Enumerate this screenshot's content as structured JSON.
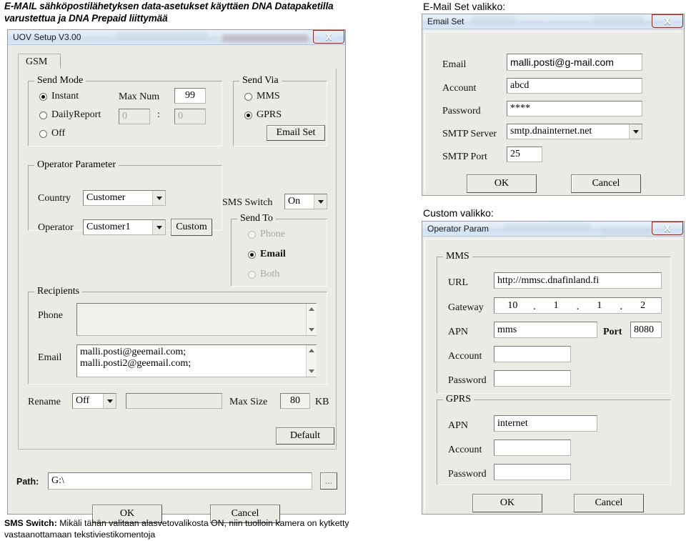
{
  "document": {
    "heading": "E-MAIL sähköpostilähetyksen data-asetukset käyttäen DNA Datapaketilla varustettua ja DNA Prepaid liittymää",
    "footnote_bold": "SMS Switch:",
    "footnote_rest": " Mikäli tähän valitaan alasvetovalikosta ON, niin tuolloin kamera on kytketty vastaanottamaan tekstiviestikomentoja",
    "caption_email_set": "E-Mail Set valikko:",
    "caption_custom": "Custom valikko:"
  },
  "main_dialog": {
    "title": "UOV Setup V3.00",
    "close_label": "X",
    "tab": "GSM",
    "send_mode": {
      "legend": "Send Mode",
      "options": [
        {
          "label": "Instant",
          "selected": true,
          "disabled": false
        },
        {
          "label": "DailyReport",
          "selected": false,
          "disabled": false
        },
        {
          "label": "Off",
          "selected": false,
          "disabled": false
        }
      ],
      "max_num_label": "Max Num",
      "max_num_value": "99",
      "daily_hour": "0",
      "daily_separator": ":",
      "daily_minute": "0"
    },
    "send_via": {
      "legend": "Send Via",
      "options": [
        {
          "label": "MMS",
          "selected": false
        },
        {
          "label": "GPRS",
          "selected": true
        }
      ],
      "email_set_button": "Email Set"
    },
    "operator_parameter": {
      "legend": "Operator Parameter",
      "country_label": "Country",
      "country_value": "Customer",
      "operator_label": "Operator",
      "operator_value": "Customer1",
      "custom_button": "Custom"
    },
    "sms_switch": {
      "label": "SMS Switch",
      "value": "On"
    },
    "send_to": {
      "legend": "Send To",
      "options": [
        {
          "label": "Phone",
          "selected": false,
          "disabled": true
        },
        {
          "label": "Email",
          "selected": true,
          "disabled": false
        },
        {
          "label": "Both",
          "selected": false,
          "disabled": true
        }
      ]
    },
    "recipients": {
      "legend": "Recipients",
      "phone_label": "Phone",
      "phone_value": "",
      "email_label": "Email",
      "email_value": "malli.posti@geemail.com;\nmalli.posti2@geemail.com;"
    },
    "rename": {
      "label": "Rename",
      "value": "Off",
      "text_value": ""
    },
    "max_size": {
      "label": "Max Size",
      "value": "80",
      "unit": "KB"
    },
    "default_button": "Default",
    "path": {
      "label": "Path:",
      "value": "G:\\",
      "browse_button": "..."
    },
    "ok_button": "OK",
    "cancel_button": "Cancel"
  },
  "email_set_dialog": {
    "title": "Email Set",
    "close_label": "X",
    "fields": [
      {
        "label": "Email",
        "value": "malli.posti@g-mail.com"
      },
      {
        "label": "Account",
        "value": "abcd"
      },
      {
        "label": "Password",
        "value": "****"
      },
      {
        "label": "SMTP Server",
        "value": "smtp.dnainternet.net"
      },
      {
        "label": "SMTP Port",
        "value": "25"
      }
    ],
    "ok_button": "OK",
    "cancel_button": "Cancel"
  },
  "operator_param_dialog": {
    "title": "Operator Param",
    "close_label": "X",
    "mms": {
      "legend": "MMS",
      "url_label": "URL",
      "url_value": "http://mmsc.dnafinland.fi",
      "gateway_label": "Gateway",
      "gateway_octets": [
        "10",
        "1",
        "1",
        "2"
      ],
      "apn_label": "APN",
      "apn_value": "mms",
      "port_label": "Port",
      "port_value": "8080",
      "account_label": "Account",
      "account_value": "",
      "password_label": "Password",
      "password_value": ""
    },
    "gprs": {
      "legend": "GPRS",
      "apn_label": "APN",
      "apn_value": "internet",
      "account_label": "Account",
      "account_value": "",
      "password_label": "Password",
      "password_value": ""
    },
    "ok_button": "OK",
    "cancel_button": "Cancel"
  }
}
